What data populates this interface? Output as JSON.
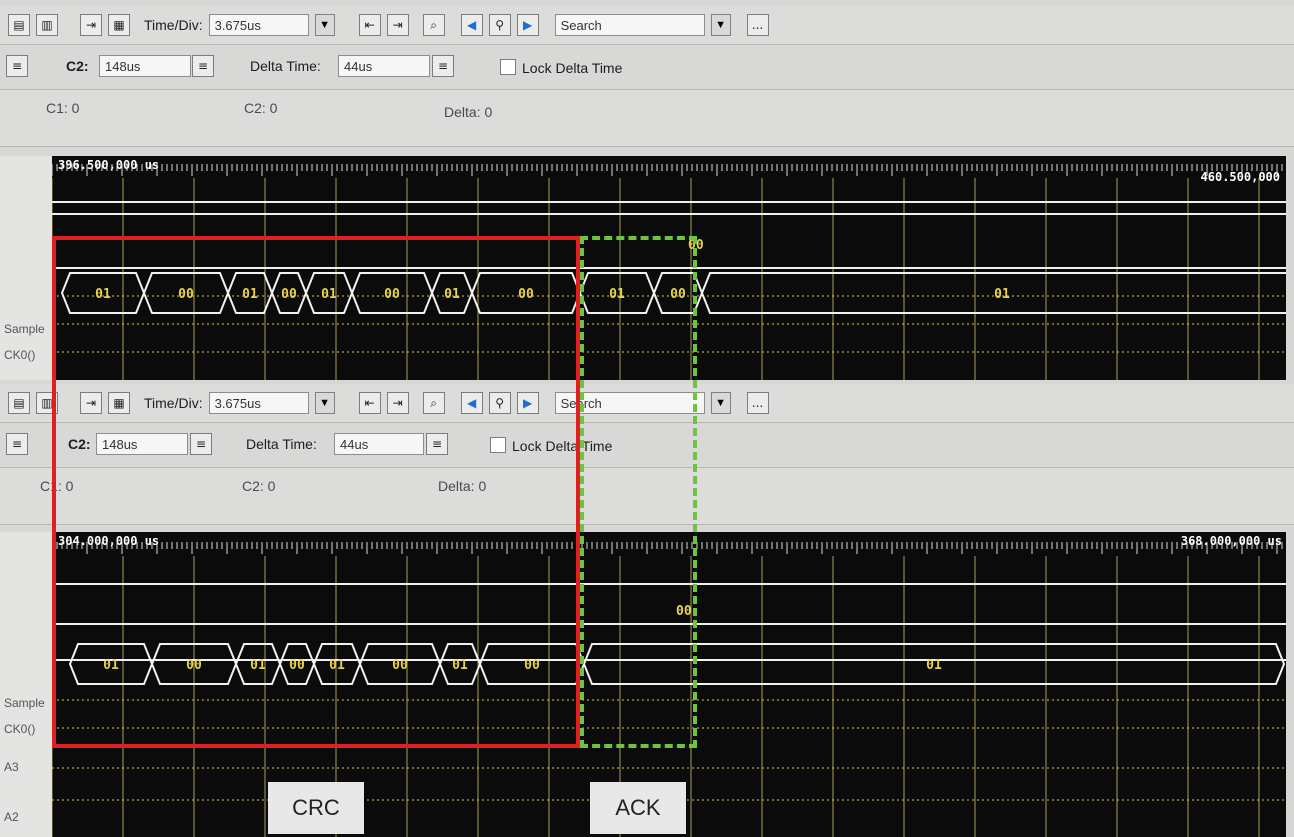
{
  "panels": [
    {
      "id": "top",
      "toolbar": {
        "time_div_label": "Time/Div:",
        "time_div_value": "3.675us",
        "search_value": "Search",
        "more_label": "..."
      },
      "cursors": {
        "c2_label": "C2:",
        "c2_value": "148us",
        "delta_label": "Delta Time:",
        "delta_value": "44us",
        "lock_label": "Lock Delta Time"
      },
      "status": {
        "c1": "C1: 0",
        "c2": "C2: 0",
        "delta": "Delta: 0"
      },
      "ruler": {
        "start": "396.500,000 us",
        "end": "460.500,000"
      },
      "signals": [
        "Sample",
        "CK0()"
      ],
      "bus_values": [
        "01",
        "00",
        "01",
        "00",
        "01",
        "00",
        "01",
        "00",
        "01",
        "00",
        "01"
      ],
      "extra_value": "00"
    },
    {
      "id": "bottom",
      "toolbar": {
        "time_div_label": "Time/Div:",
        "time_div_value": "3.675us",
        "search_value": "Search",
        "more_label": "..."
      },
      "cursors": {
        "c2_label": "C2:",
        "c2_value": "148us",
        "delta_label": "Delta Time:",
        "delta_value": "44us",
        "lock_label": "Lock Delta Time"
      },
      "status": {
        "c1": "C1: 0",
        "c2": "C2: 0",
        "delta": "Delta: 0"
      },
      "ruler": {
        "start": "304.000,000 us",
        "end": "368.000,000 us"
      },
      "signals": [
        "Sample",
        "CK0()",
        "A3",
        "A2"
      ],
      "bus_values": [
        "01",
        "00",
        "01",
        "00",
        "01",
        "00",
        "01",
        "00",
        "01"
      ],
      "extra_value": "00"
    }
  ],
  "annotations": {
    "crc": "CRC",
    "ack": "ACK"
  },
  "colors": {
    "crc_box": "#e02020",
    "ack_box": "#6cc63d",
    "bus_text": "#e7d44a",
    "scope_bg": "#0b0b0b"
  }
}
